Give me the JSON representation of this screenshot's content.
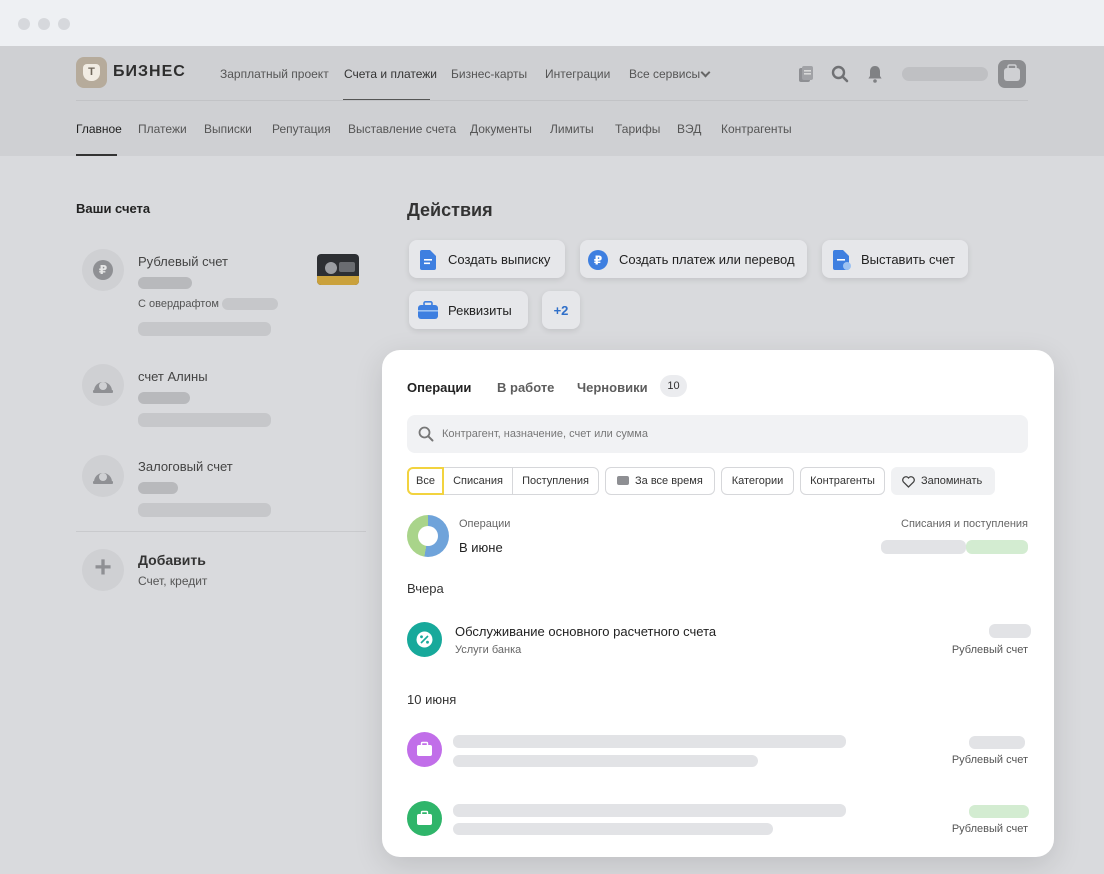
{
  "brand": {
    "name": "БИЗНЕС",
    "logo_letter": "Т"
  },
  "top_nav": [
    "Зарплатный проект",
    "Счета и платежи",
    "Бизнес-карты",
    "Интеграции",
    "Все сервисы"
  ],
  "sub_nav": [
    "Главное",
    "Платежи",
    "Выписки",
    "Репутация",
    "Выставление счета",
    "Документы",
    "Лимиты",
    "Тарифы",
    "ВЭД",
    "Контрагенты"
  ],
  "accounts": {
    "title": "Ваши счета",
    "items": [
      {
        "name": "Рублевый счет",
        "note": "С овердрафтом",
        "icon_glyph": "₽"
      },
      {
        "name": "счет Алины"
      },
      {
        "name": "Залоговый счет"
      }
    ],
    "add": {
      "title": "Добавить",
      "subtitle": "Счет, кредит",
      "icon_glyph": "+"
    }
  },
  "actions": {
    "title": "Действия",
    "buttons": [
      "Создать выписку",
      "Создать платеж или перевод",
      "Выставить счет",
      "Реквизиты"
    ],
    "more": "+2"
  },
  "operations": {
    "tabs": [
      "Операции",
      "В работе",
      "Черновики"
    ],
    "drafts_count": "10",
    "search_placeholder": "Контрагент, назначение, счет или сумма",
    "filters": [
      "Все",
      "Списания",
      "Поступления",
      "За все время",
      "Категории",
      "Контрагенты",
      "Запоминать"
    ],
    "summary": {
      "label": "Операции",
      "month": "В июне",
      "right_label": "Списания и поступления"
    },
    "groups": [
      {
        "date": "Вчера",
        "items": [
          {
            "title": "Обслуживание основного расчетного счета",
            "subtitle": "Услуги банка",
            "account": ""
          }
        ]
      },
      {
        "date": "10 июня",
        "items": [
          {
            "account": "Рублевый счет"
          },
          {
            "account": "Рублевый счет"
          }
        ]
      }
    ],
    "first_account": "Рублевый счет"
  },
  "colors": {
    "accent_yellow": "#f2d33f",
    "teal": "#17a99b",
    "purple": "#c16ee9",
    "green": "#2fb56a",
    "blue": "#3e7fe0"
  }
}
